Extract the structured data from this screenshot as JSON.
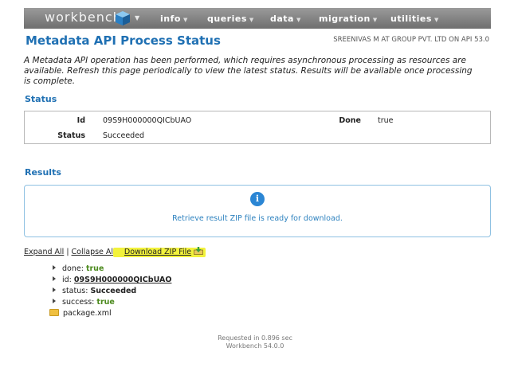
{
  "nav": {
    "brand": "workbench",
    "items": [
      {
        "label": "info"
      },
      {
        "label": "queries"
      },
      {
        "label": "data"
      },
      {
        "label": "migration"
      },
      {
        "label": "utilities"
      }
    ]
  },
  "header": {
    "title": "Metadata API Process Status",
    "user_info": "SREENIVAS M AT GROUP PVT. LTD ON API 53.0"
  },
  "info_text": "A Metadata API operation has been performed, which requires asynchronous processing as resources are available. Refresh this page periodically to view the latest status. Results will be available once processing is complete.",
  "status": {
    "heading": "Status",
    "id_label": "Id",
    "id_value": "09S9H000000QICbUAO",
    "done_label": "Done",
    "done_value": "true",
    "status_label": "Status",
    "status_value": "Succeeded"
  },
  "results": {
    "heading": "Results",
    "icon": "info-icon",
    "message": "Retrieve result ZIP file is ready for download."
  },
  "links": {
    "expand_all": "Expand All",
    "collapse_all": "Collapse All",
    "separator": "|",
    "download_zip": "Download ZIP File"
  },
  "tree": {
    "done_key": "done:",
    "done_value": "true",
    "id_key": "id:",
    "id_value": "09S9H000000QICbUAO",
    "status_key": "status:",
    "status_value": "Succeeded",
    "success_key": "success:",
    "success_value": "true",
    "file": "package.xml"
  },
  "footer": {
    "timing": "Requested in 0.896 sec",
    "version": "Workbench 54.0.0"
  },
  "colors": {
    "accent": "#1f70b3",
    "navbar": "#7f7f7f",
    "highlight": "#f2f23c",
    "true_value": "#4c8a1e"
  }
}
